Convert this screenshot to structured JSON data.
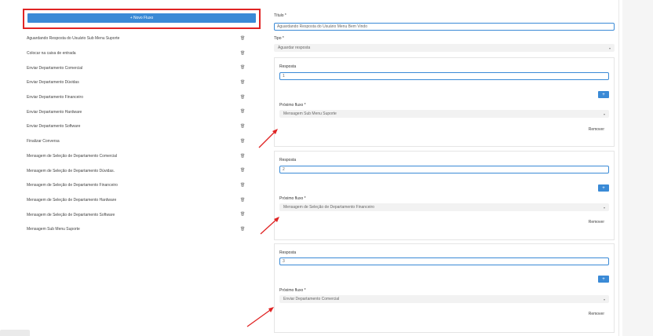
{
  "new_flow_button": "+ Novo Fluxo",
  "flows": [
    "Aguardando Resposta do Usuário Sub Menu Suporte",
    "Colocar na caixa de entrada",
    "Enviar Departamento Comercial",
    "Enviar Departamento Dúvidas",
    "Enviar Departamento Financeiro",
    "Enviar Departamento Hardware",
    "Enviar Departamento Software",
    "Finalizar Conversa",
    "Mensagem de Seleção de Departamento Comercial",
    "Mensagem de Seleção de Departamento Dúvidas.",
    "Mensagem de Seleção de Departamento Financeiro",
    "Mensagem de Seleção de Departamento Hardware",
    "Mensagem de Seleção de Departamento Software",
    "Mensagem Sub Menu Suporte"
  ],
  "form": {
    "title_label": "Título *",
    "title_value": "Aguardando Resposta do Usuário Menu Bem Vindo",
    "type_label": "Tipo *",
    "type_value": "Aguardar resposta"
  },
  "responses": [
    {
      "label": "Resposta",
      "value": "1",
      "next_label": "Próximo fluxo *",
      "next_value": "Mensagem Sub Menu Suporte",
      "remove": "Remover"
    },
    {
      "label": "Resposta",
      "value": "2",
      "next_label": "Próximo fluxo *",
      "next_value": "Mensagem de Seleção de Departamento Financeiro",
      "remove": "Remover"
    },
    {
      "label": "Resposta",
      "value": "3",
      "next_label": "Próximo fluxo *",
      "next_value": "Enviar Departamento Comercial",
      "remove": "Remover"
    }
  ],
  "icons": {
    "trash": "trash-icon",
    "plus": "plus-icon",
    "chevron": "chevron-down-icon",
    "arrow": "red-arrow-annotation"
  },
  "colors": {
    "accent": "#3a8ad6",
    "highlight": "#e02424"
  }
}
